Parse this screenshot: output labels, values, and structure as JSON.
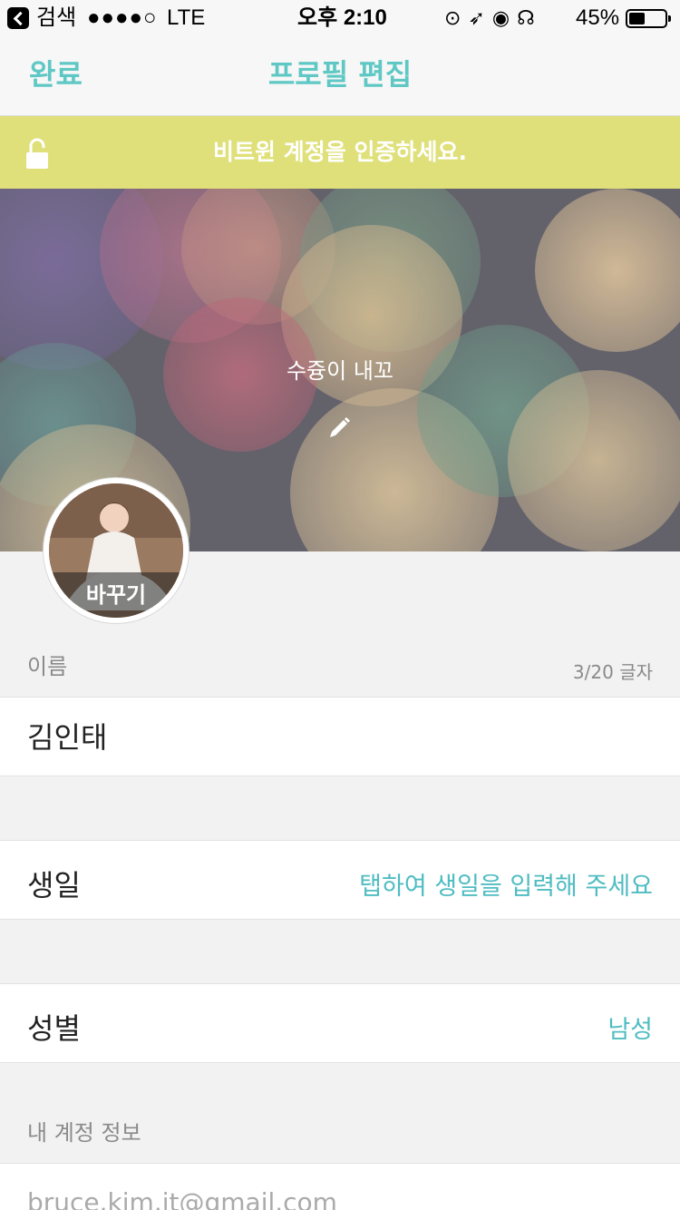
{
  "status_bar": {
    "back_label": "검색",
    "signal": "●●●●○",
    "carrier": "LTE",
    "time": "오후 2:10",
    "icons": [
      "rotation-lock-icon",
      "location-icon",
      "alarm-icon",
      "headphones-icon"
    ],
    "battery_percent": "45%",
    "battery_level": 0.45
  },
  "nav": {
    "done_label": "완료",
    "title": "프로필 편집"
  },
  "verify_banner": {
    "text": "비트윈 계정을 인증하세요.",
    "icon": "unlock-icon"
  },
  "cover": {
    "caption": "수즁이 내꼬",
    "edit_icon": "pencil-icon"
  },
  "avatar": {
    "change_label": "바꾸기"
  },
  "name_section": {
    "label": "이름",
    "count": "3/20 글자",
    "value": "김인태"
  },
  "birthday": {
    "label": "생일",
    "placeholder": "탭하여 생일을 입력해 주세요"
  },
  "gender": {
    "label": "성별",
    "value": "남성"
  },
  "account_section": {
    "label": "내 계정 정보",
    "email": "bruce.kim.it@gmail.com"
  },
  "colors": {
    "accent": "#5fc8c4",
    "banner": "#dfe07a"
  }
}
